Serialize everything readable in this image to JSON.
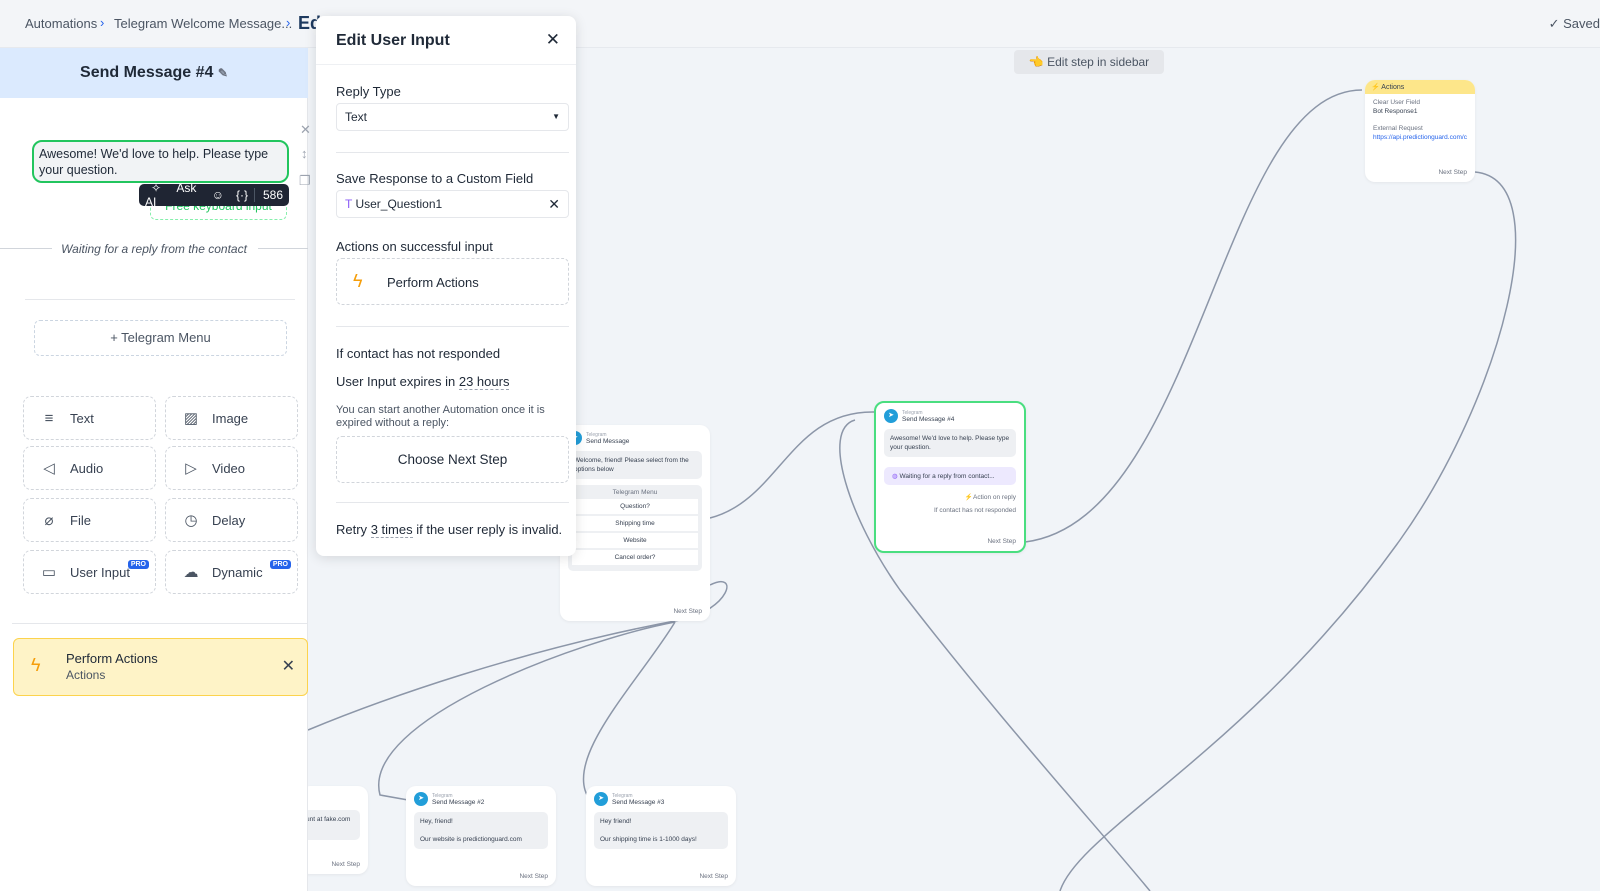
{
  "breadcrumb": {
    "items": [
      "Automations",
      "Telegram Welcome Message...",
      "Ed"
    ]
  },
  "status": {
    "saved": "Saved"
  },
  "sidebar": {
    "title": "Send Message #4",
    "message": "Awesome! We'd love to help. Please type your question.",
    "ask_ai": "Ask AI",
    "char_count": "586",
    "free_keyboard": "Free keyboard input",
    "waiting": "Waiting for a reply from the contact",
    "telegram_menu": "+ Telegram Menu",
    "tiles": [
      {
        "label": "Text",
        "icon": "text-lines-icon"
      },
      {
        "label": "Image",
        "icon": "image-icon"
      },
      {
        "label": "Audio",
        "icon": "speaker-icon"
      },
      {
        "label": "Video",
        "icon": "video-icon"
      },
      {
        "label": "File",
        "icon": "paperclip-icon"
      },
      {
        "label": "Delay",
        "icon": "clock-icon"
      },
      {
        "label": "User Input",
        "icon": "input-icon",
        "badge": "PRO"
      },
      {
        "label": "Dynamic",
        "icon": "cloud-icon",
        "badge": "PRO"
      }
    ],
    "perform": {
      "title": "Perform Actions",
      "subtitle": "Actions"
    }
  },
  "modal": {
    "title": "Edit User Input",
    "reply_type_label": "Reply Type",
    "reply_type": "Text",
    "save_label": "Save Response to a Custom Field",
    "field": "User_Question1",
    "actions_label": "Actions on successful input",
    "perform_actions": "Perform Actions",
    "no_response_label": "If contact has not responded",
    "expires_prefix": "User Input expires in",
    "expires_value": "23 hours",
    "note": "You can start another Automation once it is expired without a reply:",
    "choose_next": "Choose Next Step",
    "retry_prefix": "Retry",
    "retry_value": "3 times",
    "retry_suffix": "if the user reply is invalid."
  },
  "canvas": {
    "hint": "Edit step in sidebar",
    "actions_node": {
      "title": "Actions",
      "item1_label": "Clear User Field",
      "item1_value": "Bot Response1",
      "item2_label": "External Request",
      "item2_value": "https://api.predictionguard.com/c",
      "next": "Next Step"
    },
    "send_message": {
      "platform": "Telegram",
      "title": "Send Message",
      "text": "Welcome, friend! Please select from the options below",
      "menu_title": "Telegram Menu",
      "options": [
        "Question?",
        "Shipping time",
        "Website",
        "Cancel order?"
      ],
      "next": "Next Step"
    },
    "send4": {
      "platform": "Telegram",
      "title": "Send Message #4",
      "text": "Awesome! We'd love to help. Please type your question.",
      "waiting": "Waiting for a reply from contact...",
      "action_on_reply": "Action on reply",
      "not_responded": "If contact has not responded",
      "next": "Next Step"
    },
    "send2": {
      "platform": "Telegram",
      "title": "Send Message #2",
      "line1": "Hey, friend!",
      "line2": "Our website is predictionguard.com",
      "next": "Next Step"
    },
    "send3": {
      "platform": "Telegram",
      "title": "Send Message #3",
      "line1": "Hey friend!",
      "line2": "Our shipping time is 1-1000 days!",
      "next": "Next Step"
    },
    "partial": {
      "text": "unt at fake.com",
      "next": "Next Step"
    }
  }
}
